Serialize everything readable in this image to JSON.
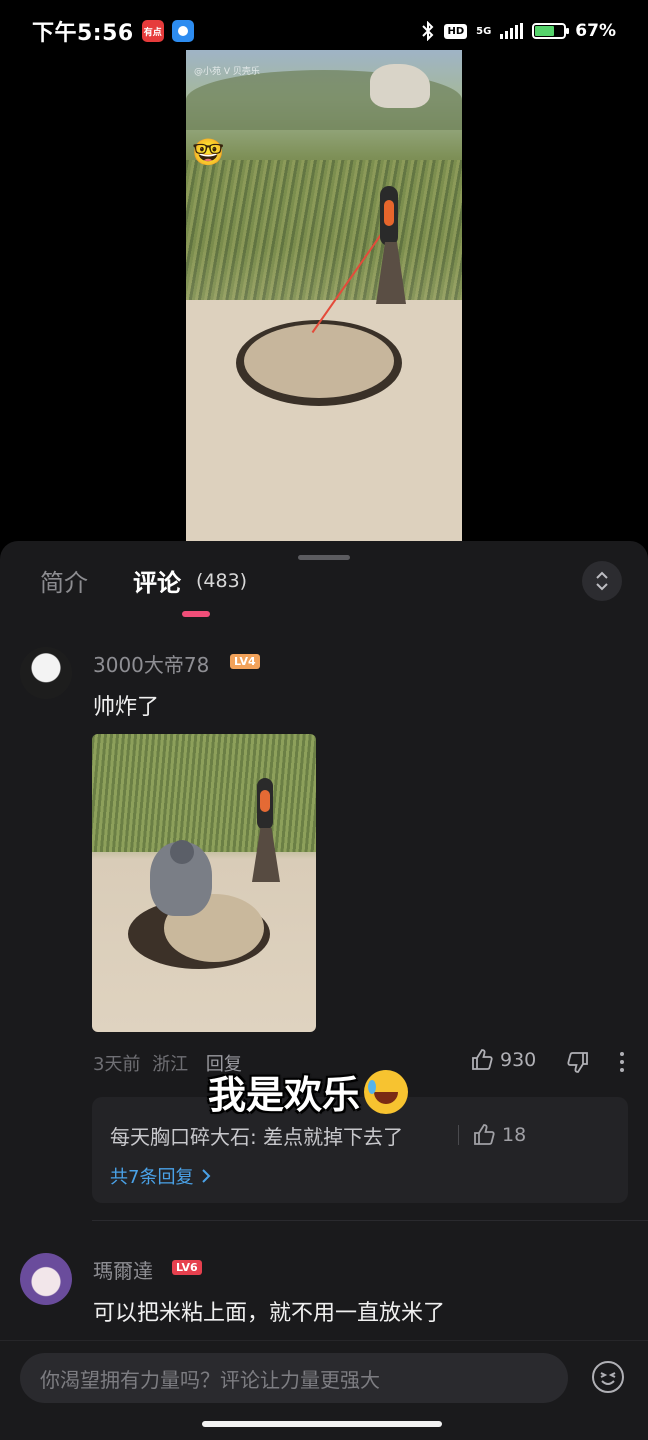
{
  "status_bar": {
    "time": "下午5:56",
    "app_badge": "有点",
    "network": "5G",
    "hd": "HD",
    "battery_percent": "67%",
    "battery_level": 0.67,
    "battery_color": "#55d26b"
  },
  "video": {
    "watermark": "@小苑 V 贝壳乐",
    "badge_emoji": "🤓"
  },
  "tabs": {
    "intro_label": "简介",
    "comments_label": "评论",
    "comments_count": "(483)",
    "active_indicator_color": "#f04e78"
  },
  "comments": [
    {
      "username": "3000大帝78",
      "level": "LV4",
      "text": "帅炸了",
      "has_image": true,
      "time": "3天前",
      "location": "浙江",
      "reply_label": "回复",
      "likes": "930",
      "top_reply": {
        "text": "每天胸口碎大石: 差点就掉下去了",
        "likes": "18"
      },
      "view_replies_label": "共7条回复"
    },
    {
      "username": "瑪爾達",
      "level": "LV6",
      "text": "可以把米粘上面，就不用一直放米了"
    }
  ],
  "overlay_caption": "我是欢乐",
  "input": {
    "placeholder": "你渴望拥有力量吗？评论让力量更强大"
  },
  "icons": {
    "expand": "expand-collapse-icon",
    "like": "thumb-up-icon",
    "dislike": "thumb-down-icon",
    "more": "more-vertical-icon",
    "emoji": "emoji-icon",
    "chevron": "chevron-right-icon"
  }
}
